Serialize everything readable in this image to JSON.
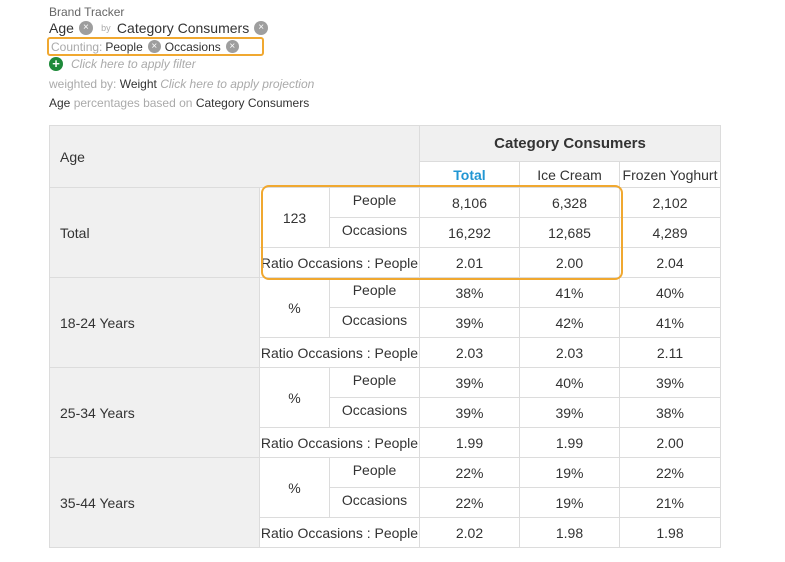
{
  "header": {
    "app_title": "Brand Tracker",
    "row_variable": "Age",
    "by_label": "by",
    "column_variable": "Category Consumers",
    "counting_label": "Counting:",
    "counting_items": [
      "People",
      "Occasions"
    ],
    "filter_placeholder": "Click here to apply filter",
    "weighted_label": "weighted by:",
    "weight_name": "Weight",
    "projection_placeholder": "Click here to apply projection",
    "basis_row": "Age",
    "basis_text": "percentages based on",
    "basis_col": "Category Consumers"
  },
  "colors": {
    "accent": "#2196d3",
    "highlight": "#f0a830",
    "add_green": "#1e8a3a"
  },
  "table": {
    "row_header": "Age",
    "column_group": "Category Consumers",
    "columns": [
      "Total",
      "Ice Cream",
      "Frozen Yoghurt"
    ],
    "total": {
      "label": "Total",
      "stat": "123",
      "rows": [
        {
          "label": "People",
          "values": [
            "8,106",
            "6,328",
            "2,102"
          ]
        },
        {
          "label": "Occasions",
          "values": [
            "16,292",
            "12,685",
            "4,289"
          ]
        },
        {
          "label": "Ratio Occasions : People",
          "values": [
            "2.01",
            "2.00",
            "2.04"
          ]
        }
      ]
    },
    "groups": [
      {
        "label": "18-24 Years",
        "stat": "%",
        "rows": [
          {
            "label": "People",
            "values": [
              "38%",
              "41%",
              "40%"
            ]
          },
          {
            "label": "Occasions",
            "values": [
              "39%",
              "42%",
              "41%"
            ]
          },
          {
            "label": "Ratio Occasions : People",
            "values": [
              "2.03",
              "2.03",
              "2.11"
            ]
          }
        ]
      },
      {
        "label": "25-34 Years",
        "stat": "%",
        "rows": [
          {
            "label": "People",
            "values": [
              "39%",
              "40%",
              "39%"
            ]
          },
          {
            "label": "Occasions",
            "values": [
              "39%",
              "39%",
              "38%"
            ]
          },
          {
            "label": "Ratio Occasions : People",
            "values": [
              "1.99",
              "1.99",
              "2.00"
            ]
          }
        ]
      },
      {
        "label": "35-44 Years",
        "stat": "%",
        "rows": [
          {
            "label": "People",
            "values": [
              "22%",
              "19%",
              "22%"
            ]
          },
          {
            "label": "Occasions",
            "values": [
              "22%",
              "19%",
              "21%"
            ]
          },
          {
            "label": "Ratio Occasions : People",
            "values": [
              "2.02",
              "1.98",
              "1.98"
            ]
          }
        ]
      }
    ]
  }
}
